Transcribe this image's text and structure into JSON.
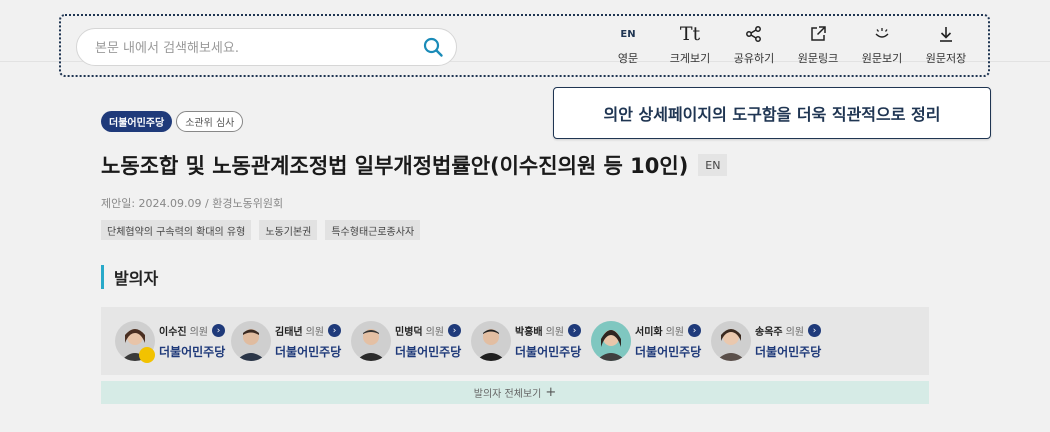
{
  "search": {
    "placeholder": "본문 내에서 검색해보세요."
  },
  "tools": [
    {
      "icon": "en-icon",
      "icon_text": "EN",
      "label": "영문"
    },
    {
      "icon": "text-size-icon",
      "icon_text": "Tt",
      "label": "크게보기"
    },
    {
      "icon": "share-icon",
      "label": "공유하기"
    },
    {
      "icon": "external-link-icon",
      "label": "원문링크"
    },
    {
      "icon": "view-icon",
      "label": "원문보기"
    },
    {
      "icon": "download-icon",
      "label": "원문저장"
    }
  ],
  "callout": "의안 상세페이지의 도구함을 더욱 직관적으로 정리",
  "bill": {
    "party_badge": "더불어민주당",
    "stage_badge": "소관위 심사",
    "title": "노동조합 및 노동관계조정법 일부개정법률안(이수진의원 등 10인)",
    "en_tag": "EN",
    "meta": "제안일: 2024.09.09 / 환경노동위원회",
    "tags": [
      "단체협약의 구속력의 확대의 유형",
      "노동기본권",
      "특수형태근로종사자"
    ]
  },
  "sponsors_section": {
    "title": "발의자",
    "role": "의원",
    "members": [
      {
        "name": "이수진",
        "party": "더불어민주당",
        "lead": true
      },
      {
        "name": "김태년",
        "party": "더불어민주당",
        "lead": false
      },
      {
        "name": "민병덕",
        "party": "더불어민주당",
        "lead": false
      },
      {
        "name": "박홍배",
        "party": "더불어민주당",
        "lead": false
      },
      {
        "name": "서미화",
        "party": "더불어민주당",
        "lead": false
      },
      {
        "name": "송옥주",
        "party": "더불어민주당",
        "lead": false
      }
    ],
    "view_all": "발의자 전체보기",
    "view_all_plus": "+"
  },
  "colors": {
    "navy": "#1f3a7a",
    "accent": "#28a9c9",
    "outline": "#1f3552"
  }
}
